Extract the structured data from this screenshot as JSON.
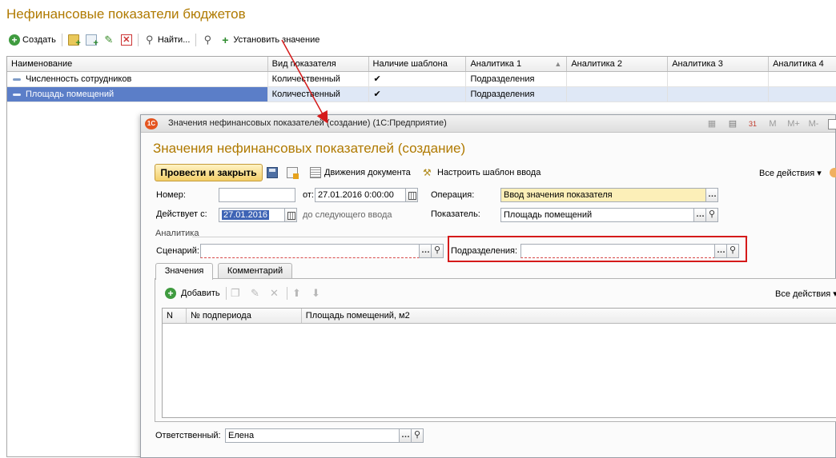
{
  "list": {
    "title": "Нефинансовые показатели бюджетов",
    "toolbar": {
      "create": "Создать",
      "find": "Найти...",
      "set_value": "Установить значение"
    },
    "columns": [
      "Наименование",
      "Вид показателя",
      "Наличие шаблона",
      "Аналитика 1",
      "Аналитика 2",
      "Аналитика 3",
      "Аналитика 4"
    ],
    "rows": [
      {
        "name": "Численность сотрудников",
        "kind": "Количественный",
        "template": "✔",
        "a1": "Подразделения",
        "a2": "",
        "a3": "",
        "a4": ""
      },
      {
        "name": "Площадь помещений",
        "kind": "Количественный",
        "template": "✔",
        "a1": "Подразделения",
        "a2": "",
        "a3": "",
        "a4": "",
        "selected": true
      }
    ]
  },
  "dialog": {
    "window_title": "Значения нефинансовых показателей (создание)  (1С:Предприятие)",
    "titlebar_buttons": [
      "M",
      "M+",
      "M-"
    ],
    "heading": "Значения нефинансовых показателей (создание)",
    "toolbar": {
      "post_close": "Провести и закрыть",
      "movements": "Движения документа",
      "template": "Настроить шаблон ввода",
      "all_actions": "Все действия ▾"
    },
    "form": {
      "number_label": "Номер:",
      "number_value": "",
      "date_label": "от:",
      "date_value": "27.01.2016  0:00:00",
      "valid_label": "Действует с:",
      "valid_value": "27.01.2016",
      "valid_hint": "до следующего ввода",
      "operation_label": "Операция:",
      "operation_value": "Ввод значения показателя",
      "indicator_label": "Показатель:",
      "indicator_value": "Площадь помещений",
      "analytics_group": "Аналитика",
      "scenario_label": "Сценарий:",
      "scenario_value": "",
      "departments_label": "Подразделения:",
      "departments_value": "",
      "responsible_label": "Ответственный:",
      "responsible_value": "Елена"
    },
    "tabs": [
      {
        "label": "Значения",
        "active": true
      },
      {
        "label": "Комментарий",
        "active": false
      }
    ],
    "values_tab": {
      "add": "Добавить",
      "all_actions": "Все действия ▾",
      "columns": [
        "N",
        "№ подпериода",
        "Площадь помещений, м2"
      ]
    }
  },
  "colors": {
    "title": "#b07a00",
    "highlight_box": "#d51a1a",
    "selection": "#5b7ec8",
    "arrow": "#d51a1a"
  }
}
